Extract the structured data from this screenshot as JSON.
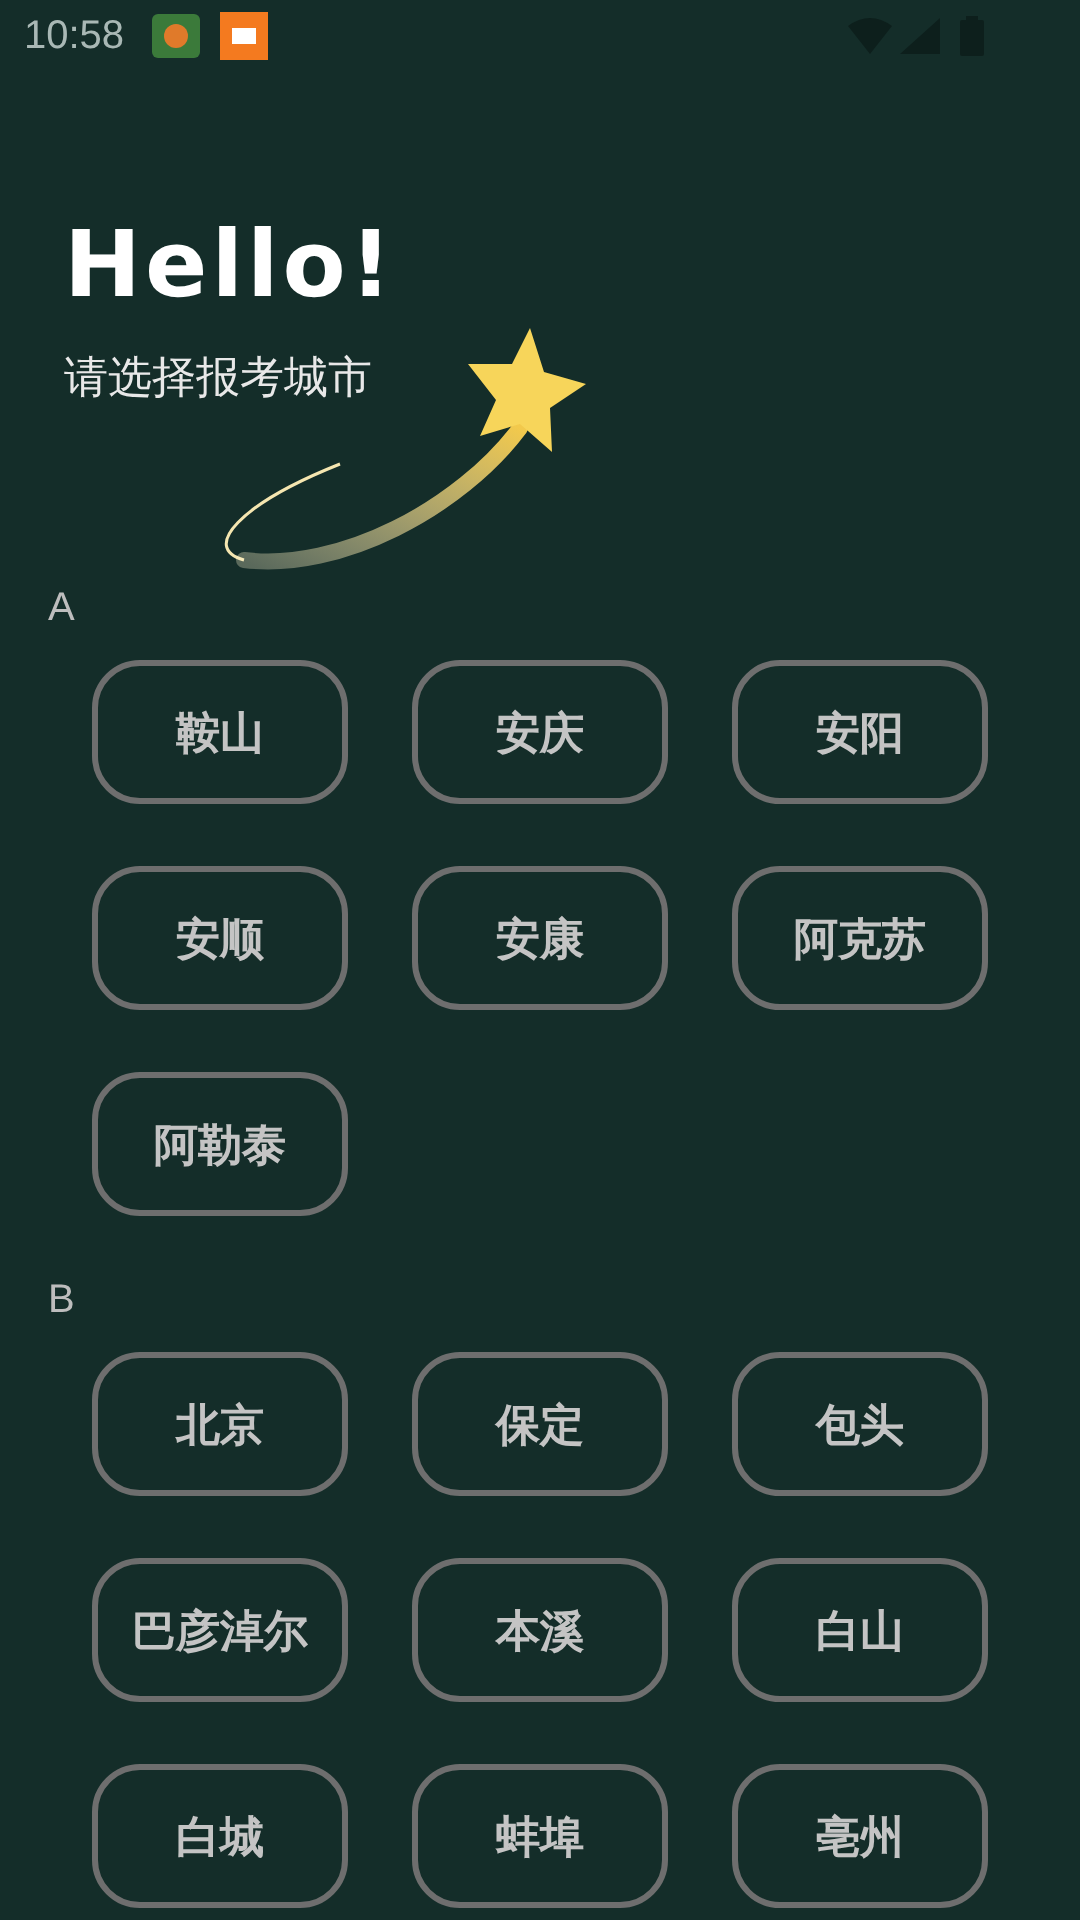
{
  "status_bar": {
    "time": "10:58"
  },
  "header": {
    "title": "Hello!",
    "subtitle": "请选择报考城市"
  },
  "sections": [
    {
      "letter": "A",
      "cities": [
        "鞍山",
        "安庆",
        "安阳",
        "安顺",
        "安康",
        "阿克苏",
        "阿勒泰"
      ]
    },
    {
      "letter": "B",
      "cities": [
        "北京",
        "保定",
        "包头",
        "巴彦淖尔",
        "本溪",
        "白山",
        "白城",
        "蚌埠",
        "亳州"
      ]
    }
  ]
}
